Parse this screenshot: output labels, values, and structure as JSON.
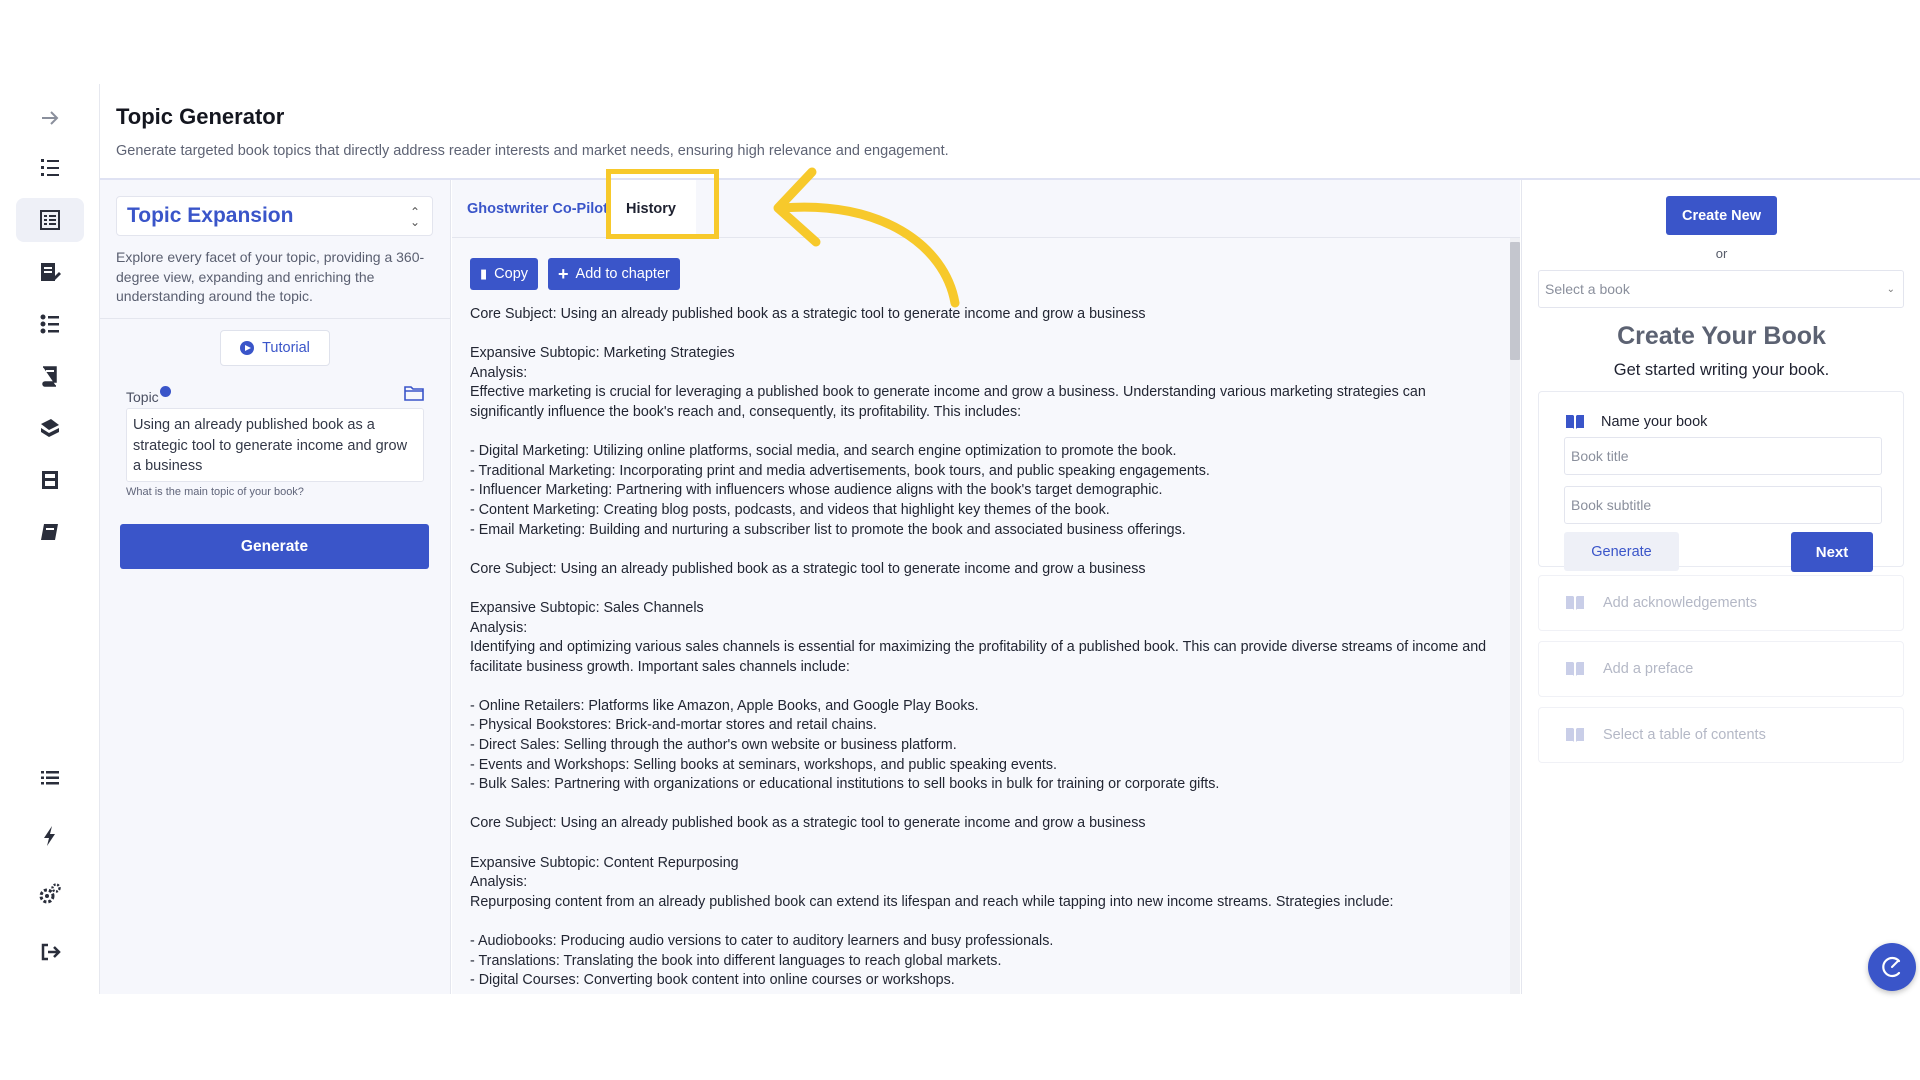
{
  "sidebar": {
    "icons": [
      "arrow-right-icon",
      "numbered-list-icon",
      "document-list-icon",
      "note-edit-icon",
      "checklist-icon",
      "book-stack-icon",
      "books-icon",
      "printer-icon",
      "book-icon",
      "list-icon",
      "lightning-icon",
      "settings-icon",
      "logout-icon"
    ]
  },
  "header": {
    "title": "Topic Generator",
    "description": "Generate targeted book topics that directly address reader interests and market needs, ensuring high relevance and engagement."
  },
  "left_panel": {
    "mode": "Topic Expansion",
    "mode_description": "Explore every facet of your topic, providing a 360-degree view, expanding and enriching the understanding around the topic.",
    "tutorial_label": "Tutorial",
    "topic_label": "Topic",
    "topic_value": "Using an already published book as a strategic tool to generate income and grow a business",
    "topic_help": "What is the main topic of your book?",
    "generate_label": "Generate"
  },
  "middle_panel": {
    "tabs": [
      {
        "label": "Ghostwriter Co-Pilot",
        "active": false
      },
      {
        "label": "History",
        "active": true
      }
    ],
    "copy_label": "Copy",
    "add_label": "Add to chapter",
    "content": "Core Subject: Using an already published book as a strategic tool to generate income and grow a business\n\nExpansive Subtopic: Marketing Strategies\nAnalysis:\nEffective marketing is crucial for leveraging a published book to generate income and grow a business. Understanding various marketing strategies can significantly influence the book's reach and, consequently, its profitability. This includes:\n\n- Digital Marketing: Utilizing online platforms, social media, and search engine optimization to promote the book.\n- Traditional Marketing: Incorporating print and media advertisements, book tours, and public speaking engagements.\n- Influencer Marketing: Partnering with influencers whose audience aligns with the book's target demographic.\n- Content Marketing: Creating blog posts, podcasts, and videos that highlight key themes of the book.\n- Email Marketing: Building and nurturing a subscriber list to promote the book and associated business offerings.\n\nCore Subject: Using an already published book as a strategic tool to generate income and grow a business\n\nExpansive Subtopic: Sales Channels\nAnalysis:\nIdentifying and optimizing various sales channels is essential for maximizing the profitability of a published book. This can provide diverse streams of income and facilitate business growth. Important sales channels include:\n\n- Online Retailers: Platforms like Amazon, Apple Books, and Google Play Books.\n- Physical Bookstores: Brick-and-mortar stores and retail chains.\n- Direct Sales: Selling through the author's own website or business platform.\n- Events and Workshops: Selling books at seminars, workshops, and public speaking events.\n- Bulk Sales: Partnering with organizations or educational institutions to sell books in bulk for training or corporate gifts.\n\nCore Subject: Using an already published book as a strategic tool to generate income and grow a business\n\nExpansive Subtopic: Content Repurposing\nAnalysis:\nRepurposing content from an already published book can extend its lifespan and reach while tapping into new income streams. Strategies include:\n\n- Audiobooks: Producing audio versions to cater to auditory learners and busy professionals.\n- Translations: Translating the book into different languages to reach global markets.\n- Digital Courses: Converting book content into online courses or workshops."
  },
  "right_panel": {
    "create_new_label": "Create New",
    "or_label": "or",
    "select_placeholder": "Select a book",
    "title": "Create Your Book",
    "subtitle": "Get started writing your book.",
    "name_step_label": "Name your book",
    "book_title_placeholder": "Book title",
    "book_subtitle_placeholder": "Book subtitle",
    "generate_label": "Generate",
    "next_label": "Next",
    "steps": [
      "Add acknowledgements",
      "Add a preface",
      "Select a table of contents"
    ]
  },
  "colors": {
    "accent": "#3a55c9",
    "highlight": "#f7c92b"
  }
}
